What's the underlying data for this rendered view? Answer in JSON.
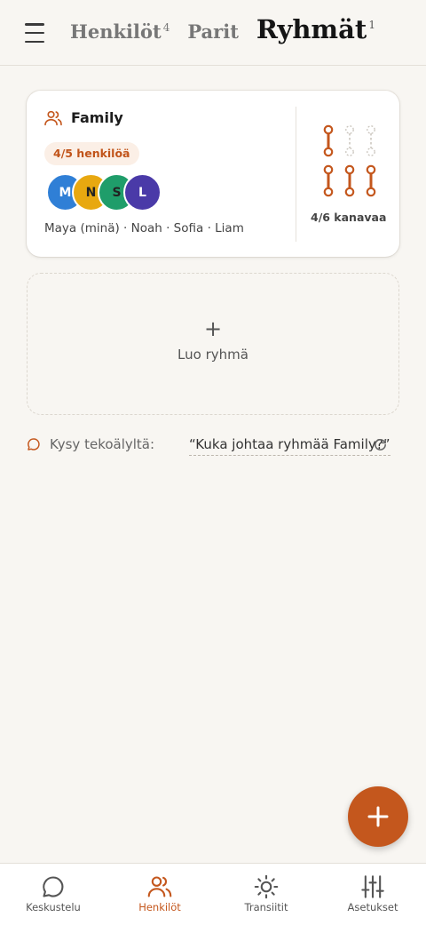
{
  "header": {
    "tabs": [
      {
        "label": "Henkilöt",
        "count": "4"
      },
      {
        "label": "Parit",
        "count": ""
      },
      {
        "label": "Ryhmät",
        "count": "1"
      }
    ]
  },
  "group": {
    "name": "Family",
    "member_count_label": "4/5 henkilöä",
    "avatars": [
      {
        "initial": "M",
        "color": "#2f7fd6"
      },
      {
        "initial": "N",
        "color": "#e8a810",
        "text_color": "#222"
      },
      {
        "initial": "S",
        "color": "#1f9d6a",
        "text_color": "#222"
      },
      {
        "initial": "L",
        "color": "#4a3aa8"
      }
    ],
    "members_text": "Maya (minä) · Noah · Sofia · Liam",
    "channels_label": "4/6 kanavaa",
    "channels_active": 4,
    "channels_total": 6,
    "accent_color": "#c4571d"
  },
  "create": {
    "plus": "+",
    "label": "Luo ryhmä"
  },
  "ask": {
    "prefix": "Kysy tekoälyltä:",
    "query": "“Kuka johtaa ryhmää Family?”"
  },
  "bottom_nav": [
    {
      "label": "Keskustelu",
      "icon": "chat-icon",
      "active": false
    },
    {
      "label": "Henkilöt",
      "icon": "people-icon",
      "active": true
    },
    {
      "label": "Transiitit",
      "icon": "sun-icon",
      "active": false
    },
    {
      "label": "Asetukset",
      "icon": "sliders-icon",
      "active": false
    }
  ]
}
